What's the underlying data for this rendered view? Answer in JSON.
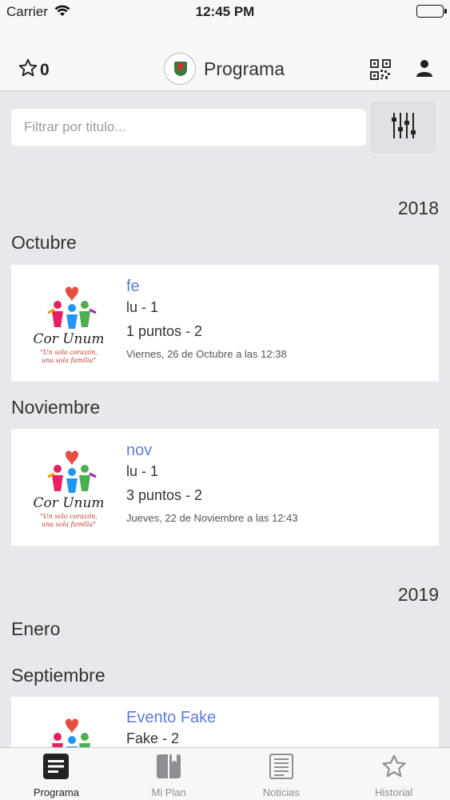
{
  "status_bar": {
    "carrier": "Carrier",
    "time": "12:45 PM"
  },
  "nav": {
    "favorites_count": "0",
    "title": "Programa"
  },
  "filter": {
    "placeholder": "Filtrar por titulo..."
  },
  "sections": {
    "year_2018": "2018",
    "month_octubre": "Octubre",
    "month_noviembre": "Noviembre",
    "year_2019": "2019",
    "month_enero": "Enero",
    "month_septiembre": "Septiembre"
  },
  "events": [
    {
      "title": "fe",
      "subtitle": "lu - 1",
      "points": "1 puntos - 2",
      "date": "Viernes, 26 de Octubre a las 12:38"
    },
    {
      "title": "nov",
      "subtitle": "lu - 1",
      "points": "3 puntos - 2",
      "date": "Jueves, 22 de Noviembre a las 12:43"
    },
    {
      "title": "Evento Fake",
      "subtitle": "Fake - 2",
      "points": "",
      "date": ""
    }
  ],
  "event_logo": {
    "line1": "Cor Unum",
    "line2": "\"Un solo corazón,",
    "line3": "una sola familia\""
  },
  "tabs": [
    {
      "label": "Programa",
      "icon": "list-icon",
      "active": true
    },
    {
      "label": "Mi Plan",
      "icon": "book-icon",
      "active": false
    },
    {
      "label": "Noticias",
      "icon": "news-icon",
      "active": false
    },
    {
      "label": "Historial",
      "icon": "star-icon",
      "active": false
    }
  ],
  "colors": {
    "accent_link": "#5b7fd6",
    "background": "#e8e7eb",
    "bar": "#f7f7f7"
  }
}
